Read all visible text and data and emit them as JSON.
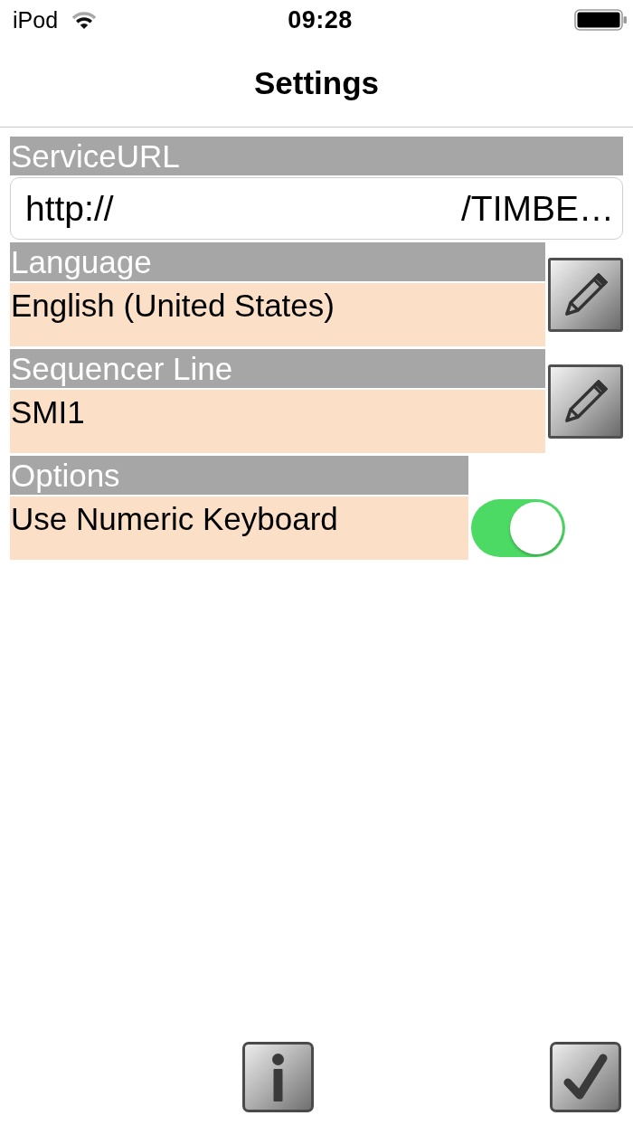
{
  "status_bar": {
    "carrier": "iPod",
    "time": "09:28"
  },
  "nav_bar": {
    "title": "Settings"
  },
  "sections": [
    {
      "kind": "field",
      "header": "ServiceURL",
      "value_start": "http://",
      "value_end": "/TIMBE…"
    },
    {
      "kind": "picker",
      "header": "Language",
      "value": "English (United States)"
    },
    {
      "kind": "picker",
      "header": "Sequencer Line",
      "value": "SMI1"
    },
    {
      "kind": "toggle",
      "header": "Options",
      "label": "Use Numeric Keyboard",
      "on": true
    }
  ]
}
